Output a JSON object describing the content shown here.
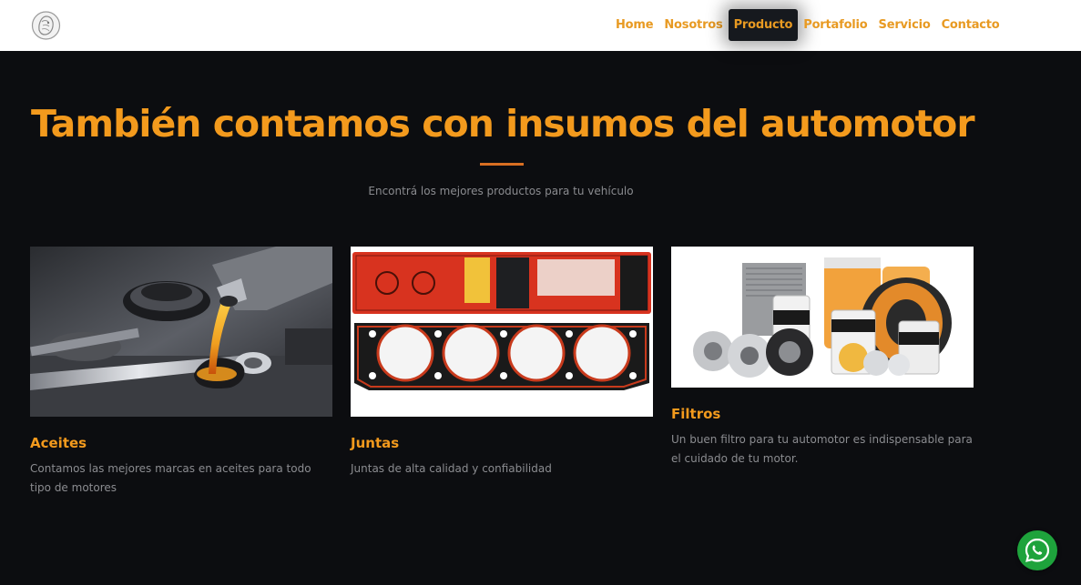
{
  "nav": {
    "items": [
      {
        "label": "Home",
        "active": false
      },
      {
        "label": "Nosotros",
        "active": false
      },
      {
        "label": "Producto",
        "active": true
      },
      {
        "label": "Portafolio",
        "active": false
      },
      {
        "label": "Servicio",
        "active": false
      },
      {
        "label": "Contacto",
        "active": false
      }
    ]
  },
  "section": {
    "title": "También contamos con insumos del automotor",
    "subtitle": "Encontrá los mejores productos para tu vehículo"
  },
  "cards": [
    {
      "title": "Aceites",
      "text": "Contamos las mejores marcas en aceites para todo tipo de motores",
      "image": "oil-pour-engine"
    },
    {
      "title": "Juntas",
      "text": "Juntas de alta calidad y confiabilidad",
      "image": "head-gasket"
    },
    {
      "title": "Filtros",
      "text": "Un buen filtro para tu automotor es indispensable para el cuidado de tu motor.",
      "image": "filters-assortment"
    }
  ],
  "colors": {
    "accent": "#f39a1d",
    "background": "#0c0d10",
    "whatsapp": "#1ea33c"
  },
  "icons": {
    "logo": "lion-crest-logo",
    "whatsapp": "whatsapp-icon"
  }
}
